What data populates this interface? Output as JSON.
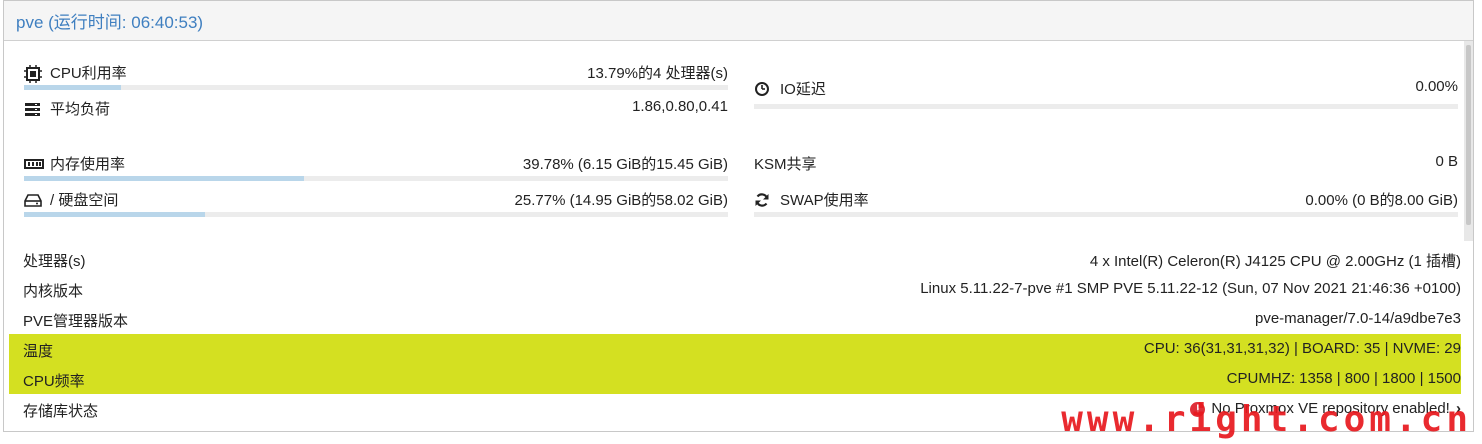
{
  "header": {
    "title": "pve (运行时间: 06:40:53)"
  },
  "metrics": {
    "cpu": {
      "label": "CPU利用率",
      "value": "13.79%的4 处理器(s)",
      "usage": 0.1379,
      "icon": "cpu-icon"
    },
    "io_delay": {
      "label": "IO延迟",
      "value": "0.00%",
      "icon": "clock-icon"
    },
    "load": {
      "label": "平均负荷",
      "value": "1.86,0.80,0.41",
      "icon": "server-icon"
    },
    "memory": {
      "label": "内存使用率",
      "value": "39.78% (6.15 GiB的15.45 GiB)",
      "usage": 0.3978,
      "icon": "memory-icon"
    },
    "ksm": {
      "label": "KSM共享",
      "value": "0 B"
    },
    "disk": {
      "label": "/ 硬盘空间",
      "value": "25.77% (14.95 GiB的58.02 GiB)",
      "usage": 0.2577,
      "icon": "hdd-icon"
    },
    "swap": {
      "label": "SWAP使用率",
      "value": "0.00% (0 B的8.00 GiB)",
      "usage": 0.0,
      "icon": "refresh-icon"
    }
  },
  "info": {
    "cpus": {
      "label": "处理器(s)",
      "value": "4 x Intel(R) Celeron(R) J4125 CPU @ 2.00GHz (1 插槽)"
    },
    "kernel": {
      "label": "内核版本",
      "value": "Linux 5.11.22-7-pve #1 SMP PVE 5.11.22-12 (Sun, 07 Nov 2021 21:46:36 +0100)"
    },
    "pve_version": {
      "label": "PVE管理器版本",
      "value": "pve-manager/7.0-14/a9dbe7e3"
    },
    "temperature": {
      "label": "温度",
      "value": "CPU: 36(31,31,31,32) | BOARD: 35 | NVME: 29"
    },
    "cpu_freq": {
      "label": "CPU频率",
      "value": "CPUMHZ: 1358 | 800 | 1800 | 1500"
    },
    "repo": {
      "label": "存储库状态",
      "value": "No Proxmox VE repository enabled!",
      "icon": "warning-icon",
      "link_icon": "chevron-right-icon"
    }
  },
  "watermark": "www.right.com.cn",
  "colors": {
    "title": "#3f7fc0",
    "bar_fill": "#b9d6ea",
    "highlight": "#d4e021",
    "warning": "#e0303a",
    "watermark": "#e8181e"
  }
}
